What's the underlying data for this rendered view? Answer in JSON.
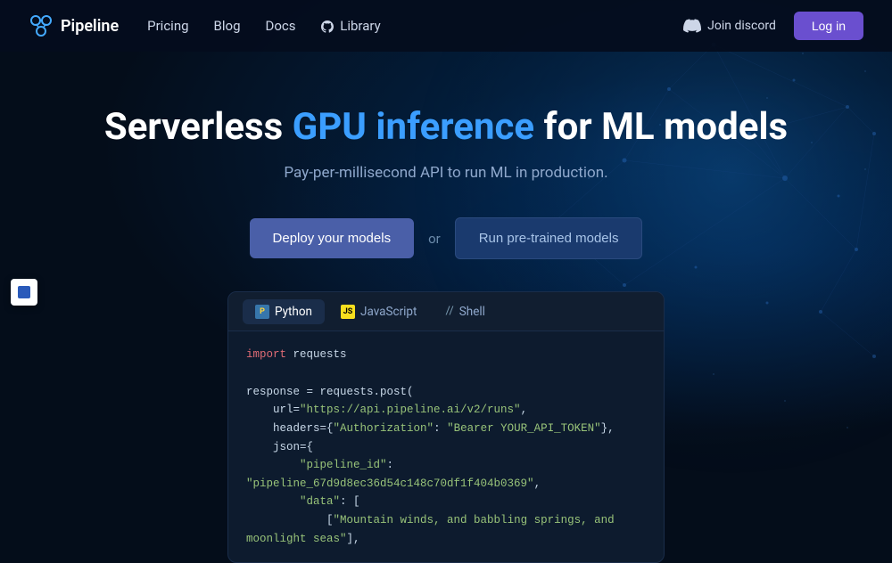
{
  "meta": {
    "title": "Pipeline - Serverless GPU inference for ML models"
  },
  "nav": {
    "logo_text": "Pipeline",
    "links": [
      {
        "label": "Pricing",
        "id": "pricing"
      },
      {
        "label": "Blog",
        "id": "blog"
      },
      {
        "label": "Docs",
        "id": "docs"
      },
      {
        "label": "Library",
        "id": "library"
      }
    ],
    "discord_label": "Join discord",
    "login_label": "Log in"
  },
  "hero": {
    "title_part1": "Serverless ",
    "title_accent": "GPU inference",
    "title_part2": " for ML models",
    "subtitle": "Pay-per-millisecond API to run ML in production.",
    "btn_deploy": "Deploy your models",
    "btn_or": "or",
    "btn_run": "Run pre-trained models"
  },
  "code_window": {
    "tabs": [
      {
        "label": "Python",
        "type": "python",
        "active": true
      },
      {
        "label": "JavaScript",
        "type": "js",
        "active": false
      },
      {
        "label": "Shell",
        "type": "shell",
        "active": false
      }
    ],
    "python_code": [
      {
        "type": "import",
        "text": "import requests"
      },
      {
        "type": "blank",
        "text": ""
      },
      {
        "type": "code",
        "text": "response = requests.post("
      },
      {
        "type": "code",
        "text": "    url=\"https://api.pipeline.ai/v2/runs\","
      },
      {
        "type": "code",
        "text": "    headers={\"Authorization\": \"Bearer YOUR_API_TOKEN\"},"
      },
      {
        "type": "code",
        "text": "    json={"
      },
      {
        "type": "code",
        "text": "        \"pipeline_id\": \"pipeline_67d9d8ec36d54c148c70df1f404b0369\","
      },
      {
        "type": "code",
        "text": "        \"data\": ["
      },
      {
        "type": "code",
        "text": "            [\"Mountain winds, and babbling springs, and moonlight seas\"],"
      }
    ]
  }
}
